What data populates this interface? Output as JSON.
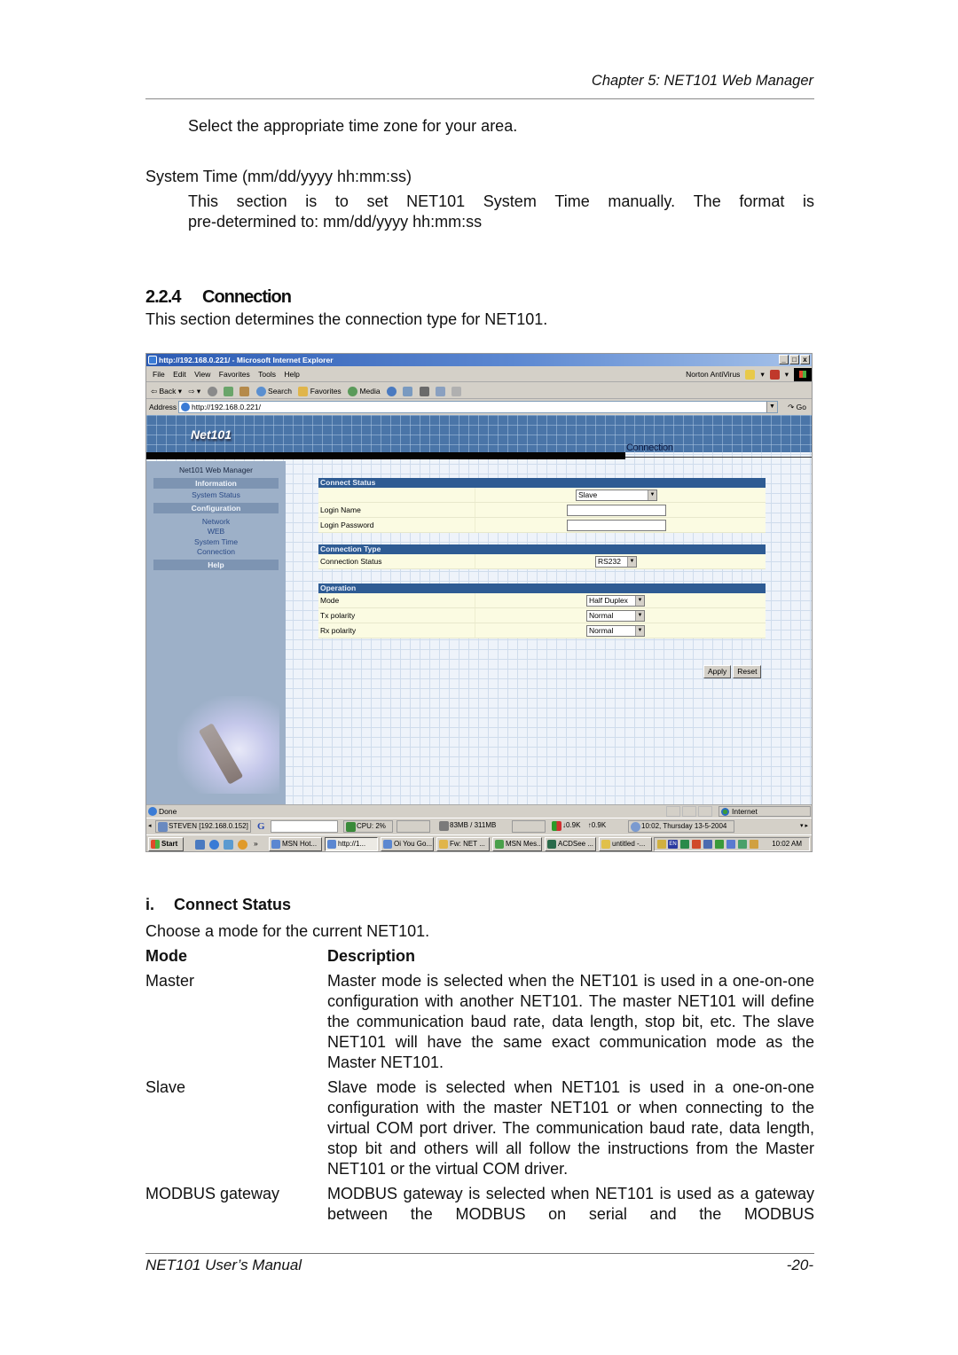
{
  "header": {
    "chapter": "Chapter 5: NET101 Web Manager"
  },
  "intro": {
    "timezone_text": "Select the appropriate time zone for your area.",
    "system_time_label": "System Time (mm/dd/yyyy hh:mm:ss)",
    "system_time_desc_line1_words": [
      "This",
      "section",
      "is",
      "to",
      "set",
      "NET101",
      "System",
      "Time",
      "manually.",
      "The",
      "format",
      "is"
    ],
    "system_time_desc_line2": "pre-determined to: mm/dd/yyyy hh:mm:ss"
  },
  "section": {
    "number": "2.2.4",
    "title": "Connection",
    "description": "This section determines the connection type for NET101."
  },
  "screenshot": {
    "browser": {
      "title": "http://192.168.0.221/ - Microsoft Internet Explorer",
      "window_buttons": [
        "_",
        "□",
        "x"
      ],
      "menu": [
        "File",
        "Edit",
        "View",
        "Favorites",
        "Tools",
        "Help"
      ],
      "norton": "Norton AntiVirus",
      "toolbar": {
        "back": "⇦ Back ▾",
        "forward": "⇨ ▾",
        "search": "Search",
        "favorites": "Favorites",
        "media": "Media"
      },
      "address_label": "Address",
      "address_value": "http://192.168.0.221/",
      "go": "Go"
    },
    "page": {
      "logo": "Net101",
      "banner_title": "Connection",
      "sidebar": {
        "title": "Net101 Web Manager",
        "information": "Information",
        "system_status": "System Status",
        "configuration": "Configuration",
        "links": [
          "Network",
          "WEB",
          "System Time",
          "Connection"
        ],
        "help": "Help"
      },
      "form": {
        "connect_status": {
          "header": "Connect Status",
          "mode_select": "Slave",
          "login_name_label": "Login Name",
          "login_name_value": "",
          "login_password_label": "Login Password",
          "login_password_value": ""
        },
        "connection_type": {
          "header": "Connection Type",
          "status_label": "Connection Status",
          "status_select": "RS232"
        },
        "operation": {
          "header": "Operation",
          "mode_label": "Mode",
          "mode_select": "Half Duplex",
          "tx_label": "Tx polarity",
          "tx_select": "Normal",
          "rx_label": "Rx polarity",
          "rx_select": "Normal"
        },
        "apply": "Apply",
        "reset": "Reset"
      }
    },
    "statusbar": {
      "text": "Done",
      "zone": "Internet"
    },
    "perfbar": {
      "host": "STEVEN [192.168.0.152]",
      "google": "G",
      "cpu": "CPU: 2%",
      "memory": "83MB / 311MB",
      "net_down": "↓0.9K",
      "net_up": "↑0.9K",
      "datetime": "10:02, Thursday 13-5-2004"
    },
    "taskbar": {
      "start": "Start",
      "tasks": [
        "MSN Hot...",
        "http://1...",
        "Oi You Go...",
        "Fw: NET ...",
        "MSN Mes...",
        "ACDSee ...",
        "untitled -..."
      ],
      "active_task_index": 1,
      "tray_lang": "EN",
      "clock": "10:02 AM"
    }
  },
  "connect_status": {
    "number": "i.",
    "title": "Connect Status",
    "intro": "Choose a mode for the current NET101.",
    "table_headers": {
      "mode": "Mode",
      "description": "Description"
    },
    "rows": [
      {
        "mode": "Master",
        "description": "Master mode is selected when the NET101 is used in a one-on-one configuration with another NET101. The master NET101 will define the communication baud rate, data length, stop bit, etc. The slave NET101 will have the same exact communication mode as the Master NET101."
      },
      {
        "mode": "Slave",
        "description": "Slave mode is selected when NET101 is used in a one-on-one configuration with the master NET101 or when connecting to the virtual COM port driver.  The communication baud rate, data length, stop bit and others will all follow the instructions from the Master NET101 or the virtual COM driver."
      },
      {
        "mode": "MODBUS gateway",
        "description": "MODBUS gateway is selected when NET101 is used as a gateway between the MODBUS on serial and the MODBUS"
      }
    ]
  },
  "footer": {
    "left": "NET101  User’s  Manual",
    "right": "-20-"
  }
}
